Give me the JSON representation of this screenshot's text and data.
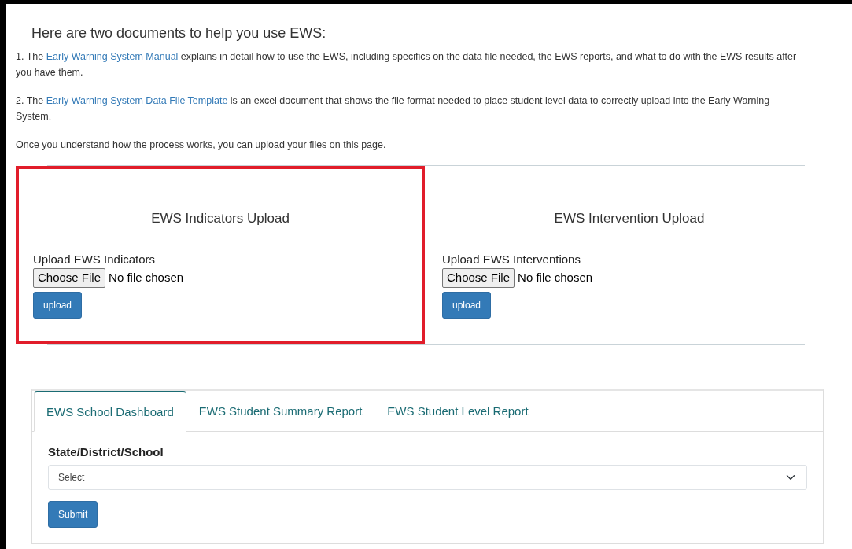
{
  "heading": "Here are two documents to help you use EWS:",
  "paragraphs": [
    {
      "before": "1. The",
      "link": "Early Warning System Manual",
      "after": "explains in detail how to use the EWS, including specifics on the data file needed, the EWS reports, and what to do with the EWS results after you have them."
    },
    {
      "before": "2. The",
      "link": "Early Warning System Data File Template",
      "after": "is an excel document that shows the file format needed to place student level data to correctly upload into the Early Warning System."
    },
    {
      "before": "Once you understand how the process works, you can upload your files on this page."
    }
  ],
  "upload_panels": [
    {
      "title": "EWS Indicators Upload",
      "label": "Upload EWS Indicators",
      "file_button": "Choose File",
      "file_status": "No file chosen",
      "button": "upload",
      "highlighted": true
    },
    {
      "title": "EWS Intervention Upload",
      "label": "Upload EWS Interventions",
      "file_button": "Choose File",
      "file_status": "No file chosen",
      "button": "upload",
      "highlighted": false
    }
  ],
  "tabs": [
    {
      "label": "EWS School Dashboard",
      "selected": true
    },
    {
      "label": "EWS Student Summary Report",
      "selected": false
    },
    {
      "label": "EWS Student Level Report",
      "selected": false
    }
  ],
  "form": {
    "label": "State/District/School",
    "select_value": "Select",
    "submit": "Submit"
  }
}
